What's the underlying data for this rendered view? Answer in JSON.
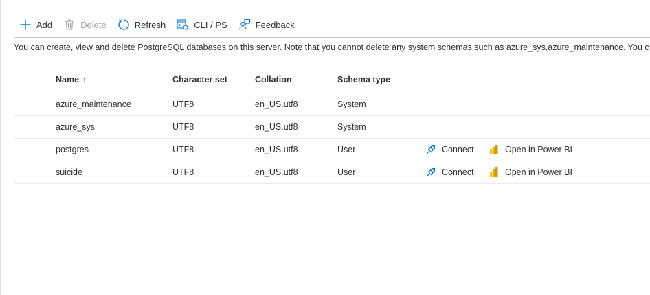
{
  "toolbar": {
    "add_label": "Add",
    "delete_label": "Delete",
    "refresh_label": "Refresh",
    "cli_label": "CLI / PS",
    "feedback_label": "Feedback"
  },
  "description": "You can create, view and delete PostgreSQL databases on this server. Note that you cannot delete any system schemas such as azure_sys,azure_maintenance. You c",
  "table": {
    "headers": {
      "name": "Name",
      "name_sort_arrow": "↑",
      "charset": "Character set",
      "collation": "Collation",
      "schema_type": "Schema type"
    },
    "rows": [
      {
        "name": "azure_maintenance",
        "charset": "UTF8",
        "collation": "en_US.utf8",
        "schema_type": "System"
      },
      {
        "name": "azure_sys",
        "charset": "UTF8",
        "collation": "en_US.utf8",
        "schema_type": "System"
      },
      {
        "name": "postgres",
        "charset": "UTF8",
        "collation": "en_US.utf8",
        "schema_type": "User",
        "connect_label": "Connect",
        "powerbi_label": "Open in Power BI"
      },
      {
        "name": "suicide",
        "charset": "UTF8",
        "collation": "en_US.utf8",
        "schema_type": "User",
        "connect_label": "Connect",
        "powerbi_label": "Open in Power BI"
      }
    ]
  },
  "colors": {
    "accent": "#0078d4",
    "powerbi_yellow": "#f2c811",
    "border": "#edebe9"
  }
}
